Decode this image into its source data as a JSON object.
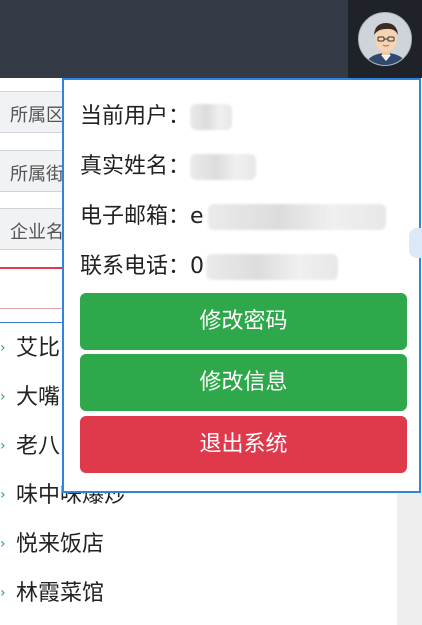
{
  "filters": {
    "district_label": "所属区",
    "street_label": "所属街",
    "company_label": "企业名"
  },
  "restaurants": [
    {
      "name": "艾比"
    },
    {
      "name": "大嘴"
    },
    {
      "name": "老八"
    },
    {
      "name": "味中味爆炒"
    },
    {
      "name": "悦来饭店"
    },
    {
      "name": "林霞菜馆"
    }
  ],
  "user_popup": {
    "current_user_label": "当前用户：",
    "real_name_label": "真实姓名：",
    "email_label": "电子邮箱：",
    "email_partial": "e",
    "phone_label": "联系电话：",
    "phone_partial": "0",
    "change_password_button": "修改密码",
    "edit_info_button": "修改信息",
    "logout_button": "退出系统"
  },
  "colors": {
    "topbar": "#343a46",
    "popup_border": "#2f84e0",
    "green_button": "#2ea84b",
    "red_button": "#de3a4b"
  },
  "icons": {
    "avatar": "user-avatar",
    "list_marker": "chevron-right-icon"
  }
}
